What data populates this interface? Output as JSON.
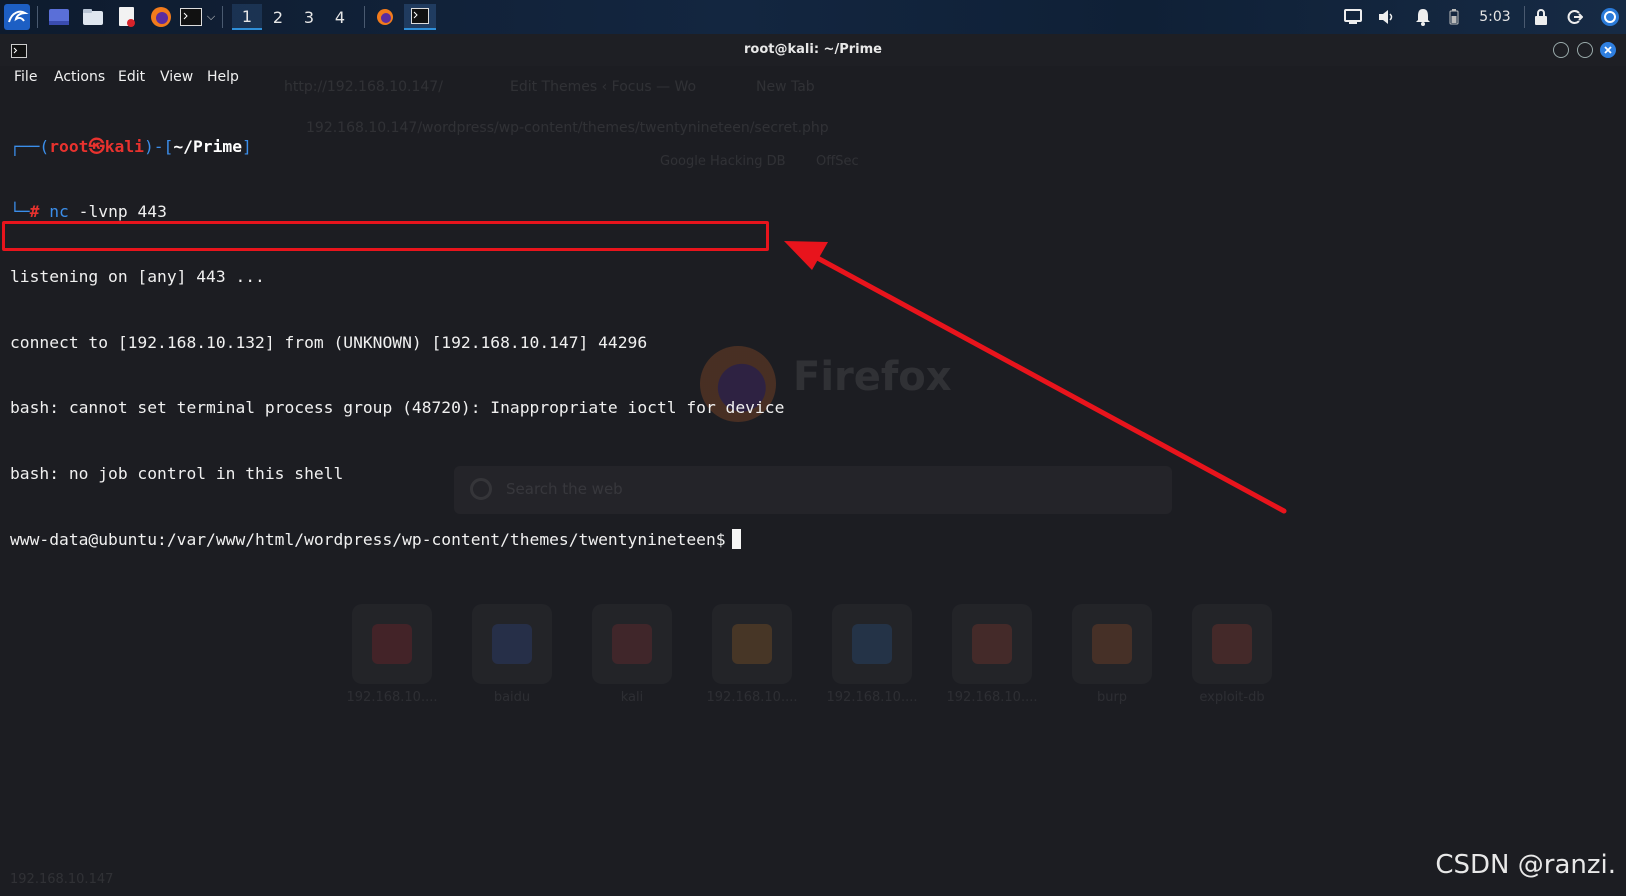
{
  "taskbar": {
    "workspaces": [
      "1",
      "2",
      "3",
      "4"
    ],
    "active_workspace": "1",
    "clock": "5:03"
  },
  "background_browser": {
    "tabs": [
      "http://192.168.10.147/",
      "Edit Themes ‹ Focus — Wo",
      "New Tab"
    ],
    "address": "192.168.10.147/wordpress/wp-content/themes/twentynineteen/secret.php",
    "bookmarks": [
      "Google Hacking DB",
      "OffSec"
    ],
    "logo_text": "Firefox",
    "search_placeholder": "Search the web",
    "shortcuts": [
      {
        "label": "192.168.10....",
        "color": "#d8232a"
      },
      {
        "label": "baidu",
        "color": "#3a62e0"
      },
      {
        "label": "kali",
        "color": "#c8323a"
      },
      {
        "label": "192.168.10....",
        "color": "#f08a24"
      },
      {
        "label": "192.168.10....",
        "color": "#2a7ad8"
      },
      {
        "label": "192.168.10....",
        "color": "#e04830"
      },
      {
        "label": "burp",
        "color": "#e86a28"
      },
      {
        "label": "exploit-db",
        "color": "#e04030"
      }
    ],
    "status_url": "192.168.10.147"
  },
  "terminal": {
    "title": "root@kali: ~/Prime",
    "menu": [
      "File",
      "Actions",
      "Edit",
      "View",
      "Help"
    ],
    "prompt_user": "root",
    "prompt_symbol": "㉿",
    "prompt_host": "kali",
    "prompt_dir": "~/Prime",
    "command_name": "nc",
    "command_args": "-lvnp 443",
    "output": [
      "listening on [any] 443 ...",
      "connect to [192.168.10.132] from (UNKNOWN) [192.168.10.147] 44296",
      "bash: cannot set terminal process group (48720): Inappropriate ioctl for device",
      "bash: no job control in this shell"
    ],
    "shell_prompt": "www-data@ubuntu:/var/www/html/wordpress/wp-content/themes/twentynineteen$"
  },
  "watermark": "CSDN @ranzi.",
  "colors": {
    "annotation_red": "#e8141c",
    "prompt_blue": "#3b8eea",
    "prompt_red": "#e8322e",
    "terminal_bg": "#1c1d22"
  }
}
